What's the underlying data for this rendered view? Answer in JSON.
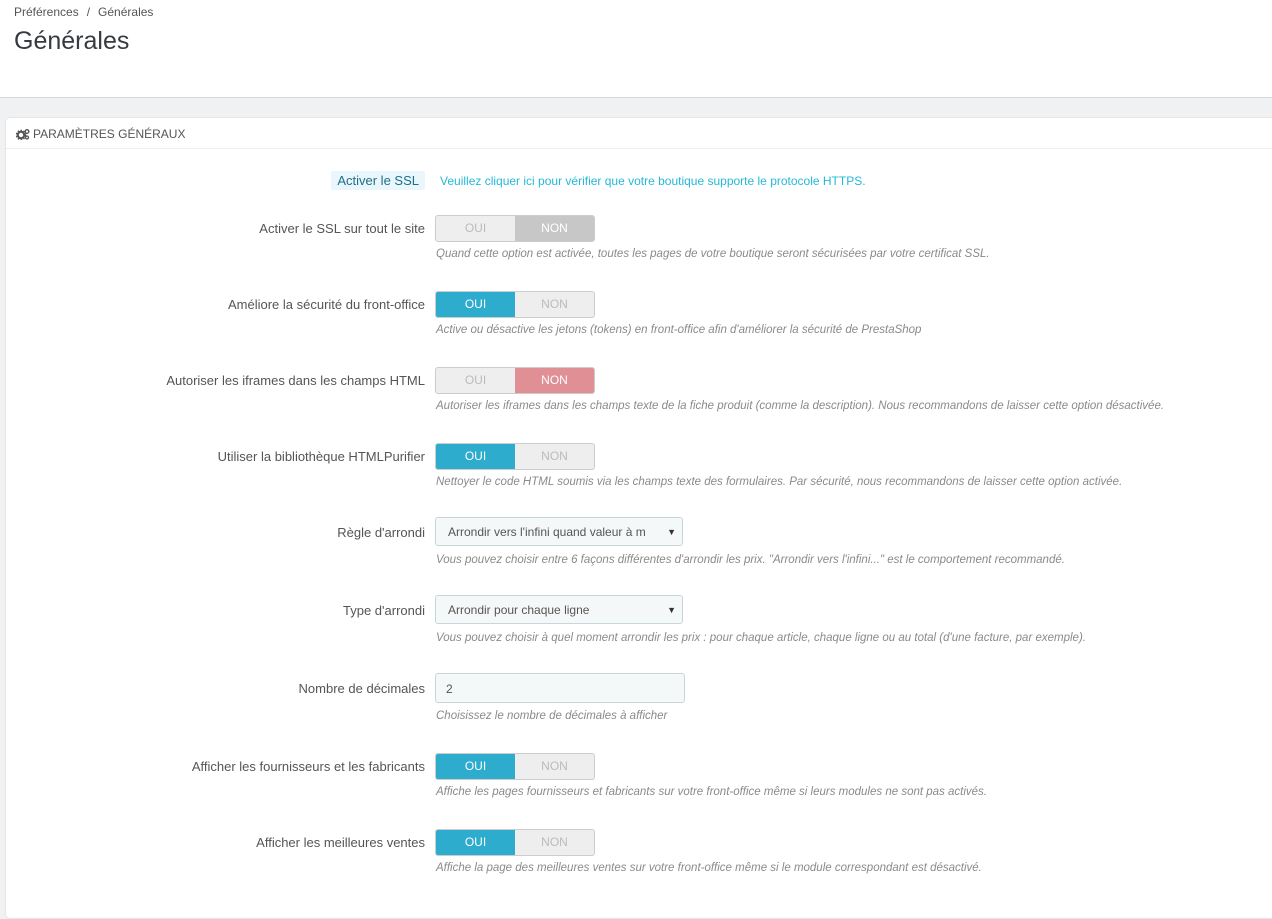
{
  "breadcrumb": {
    "parent": "Préférences",
    "separator": "/",
    "current": "Générales"
  },
  "page_title": "Générales",
  "panel": {
    "heading": "PARAMÈTRES GÉNÉRAUX",
    "icon": "cogs-icon"
  },
  "ssl": {
    "badge": "Activer le SSL",
    "link": "Veuillez cliquer ici pour vérifier que votre boutique supporte le protocole HTTPS."
  },
  "fields": [
    {
      "label": "Activer le SSL sur tout le site",
      "type": "switch",
      "yes": "OUI",
      "no": "NON",
      "value": "NON",
      "help": "Quand cette option est activée, toutes les pages de votre boutique seront sécurisées par votre certificat SSL."
    },
    {
      "label": "Améliore la sécurité du front-office",
      "type": "switch",
      "yes": "OUI",
      "no": "NON",
      "value": "OUI",
      "help": "Active ou désactive les jetons (tokens) en front-office afin d'améliorer la sécurité de PrestaShop"
    },
    {
      "label": "Autoriser les iframes dans les champs HTML",
      "type": "switch",
      "yes": "OUI",
      "no": "NON",
      "value": "NON",
      "help": "Autoriser les iframes dans les champs texte de la fiche produit (comme la description). Nous recommandons de laisser cette option désactivée."
    },
    {
      "label": "Utiliser la bibliothèque HTMLPurifier",
      "type": "switch",
      "yes": "OUI",
      "no": "NON",
      "value": "OUI",
      "help": "Nettoyer le code HTML soumis via les champs texte des formulaires. Par sécurité, nous recommandons de laisser cette option activée."
    },
    {
      "label": "Règle d'arrondi",
      "type": "select",
      "value": "Arrondir vers l'infini quand valeur à m",
      "help": "Vous pouvez choisir entre 6 façons différentes d'arrondir les prix. \"Arrondir vers l'infini...\" est le comportement recommandé."
    },
    {
      "label": "Type d'arrondi",
      "type": "select",
      "value": "Arrondir pour chaque ligne",
      "help": "Vous pouvez choisir à quel moment arrondir les prix : pour chaque article, chaque ligne ou au total (d'une facture, par exemple)."
    },
    {
      "label": "Nombre de décimales",
      "type": "input",
      "value": "2",
      "help": "Choisissez le nombre de décimales à afficher"
    },
    {
      "label": "Afficher les fournisseurs et les fabricants",
      "type": "switch",
      "yes": "OUI",
      "no": "NON",
      "value": "OUI",
      "help": "Affiche les pages fournisseurs et fabricants sur votre front-office même si leurs modules ne sont pas activés."
    },
    {
      "label": "Afficher les meilleures ventes",
      "type": "switch",
      "yes": "OUI",
      "no": "NON",
      "value": "OUI",
      "help": "Affiche la page des meilleures ventes sur votre front-office même si le module correspondant est désactivé."
    }
  ],
  "colors": {
    "accent": "#2eacce",
    "off_grey": "#c7c7c7",
    "off_red": "#e08f95",
    "link": "#25b9d7"
  }
}
